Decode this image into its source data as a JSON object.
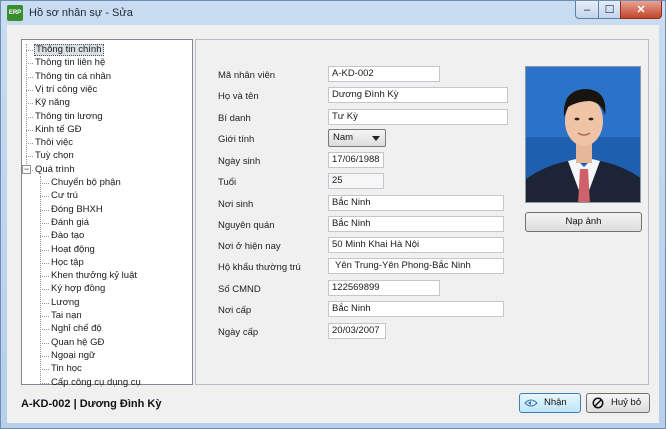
{
  "window": {
    "title": "Hồ sơ nhân sự - Sửa",
    "icon_text": "ERP",
    "minimize_icon": "–",
    "maximize_icon": "☐",
    "close_icon": "✕"
  },
  "tree": {
    "items": [
      {
        "label": "Thông tin chính",
        "selected": true
      },
      {
        "label": "Thông tin liên hệ"
      },
      {
        "label": "Thông tin cá nhân"
      },
      {
        "label": "Vị trí công việc"
      },
      {
        "label": "Kỹ năng"
      },
      {
        "label": "Thông tin lương"
      },
      {
        "label": "Kinh tế GĐ"
      },
      {
        "label": "Thôi việc"
      },
      {
        "label": "Tuỳ chọn"
      },
      {
        "label": "Quá trình",
        "expanded": true
      },
      {
        "label": "Chuyển bộ phận",
        "child": true
      },
      {
        "label": "Cư trú",
        "child": true
      },
      {
        "label": "Đóng BHXH",
        "child": true
      },
      {
        "label": "Đánh giá",
        "child": true
      },
      {
        "label": "Đào tạo",
        "child": true
      },
      {
        "label": "Hoạt động",
        "child": true
      },
      {
        "label": "Học tập",
        "child": true
      },
      {
        "label": "Khen thưởng kỷ luật",
        "child": true
      },
      {
        "label": "Ký hợp đồng",
        "child": true
      },
      {
        "label": "Lương",
        "child": true
      },
      {
        "label": "Tai nạn",
        "child": true
      },
      {
        "label": "Nghỉ chế độ",
        "child": true
      },
      {
        "label": "Quan hệ GĐ",
        "child": true
      },
      {
        "label": "Ngoại ngữ",
        "child": true
      },
      {
        "label": "Tin học",
        "child": true
      },
      {
        "label": "Cấp công cụ dụng cụ",
        "child": true
      }
    ],
    "expander_symbol": "−"
  },
  "form": {
    "employee_code": {
      "label": "Mã nhân viên",
      "value": "A-KD-002"
    },
    "full_name": {
      "label": "Họ và tên",
      "value": "Dương Đình Kỳ"
    },
    "alias": {
      "label": "Bí danh",
      "value": "Tư Kỳ"
    },
    "gender": {
      "label": "Giới tính",
      "value": "Nam"
    },
    "birth_date": {
      "label": "Ngày sinh",
      "value": "17/06/1988"
    },
    "age": {
      "label": "Tuổi",
      "value": "25"
    },
    "birth_place": {
      "label": "Nơi sinh",
      "value": "Bắc Ninh"
    },
    "hometown": {
      "label": "Nguyên quán",
      "value": "Bắc Ninh"
    },
    "current_address": {
      "label": "Nơi ở hiện nay",
      "value": "50 Minh Khai Hà Nội"
    },
    "permanent_address": {
      "label": "Hộ khẩu thường trú",
      "value": "Yên Trung-Yên Phong-Bắc Ninh"
    },
    "id_number": {
      "label": "Số CMND",
      "value": "122569899"
    },
    "issue_place": {
      "label": "Nơi cấp",
      "value": "Bắc Ninh"
    },
    "issue_date": {
      "label": "Ngày cấp",
      "value": "20/03/2007"
    }
  },
  "photo": {
    "load_button": "Nạp ảnh"
  },
  "footer": {
    "status": "A-KD-002 | Dương Đình Kỳ",
    "ok_button": "Nhận",
    "cancel_button": "Huỷ bỏ"
  },
  "colors": {
    "window_frame": "#b7cfe9",
    "close_button": "#c2452a",
    "primary_button": "#bee6fd"
  }
}
